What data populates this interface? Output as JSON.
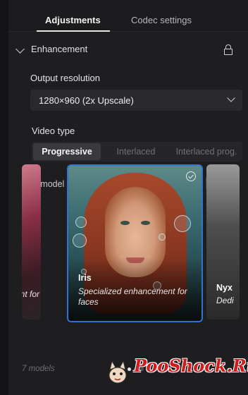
{
  "tabs": [
    {
      "label": "Adjustments",
      "active": true
    },
    {
      "label": "Codec settings",
      "active": false
    }
  ],
  "enhancement": {
    "title": "Enhancement",
    "output_resolution": {
      "label": "Output resolution",
      "value": "1280×960 (2x Upscale)"
    },
    "video_type": {
      "label": "Video type",
      "options": [
        "Progressive",
        "Interlaced",
        "Interlaced prog."
      ],
      "selected": "Progressive"
    },
    "ai_model": {
      "label": "AI model",
      "view_modes": [
        "grid-icon",
        "list-icon"
      ],
      "cards": [
        {
          "name": "",
          "description": "nt for"
        },
        {
          "name": "Iris",
          "description": "Specialized enhancement for faces",
          "selected": true
        },
        {
          "name": "Nyx",
          "description": "Dedi"
        }
      ],
      "count_text": "7 models",
      "page_dots": 3,
      "current_dot": 0
    }
  },
  "watermark": {
    "text": "PooShock.Ru"
  },
  "colors": {
    "accent": "#2f74d0",
    "background": "#1e1e20"
  }
}
